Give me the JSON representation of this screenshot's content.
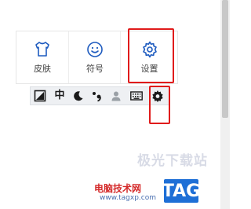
{
  "panel": {
    "items": [
      {
        "label": "皮肤",
        "icon": "shirt-icon"
      },
      {
        "label": "符号",
        "icon": "smiley-icon"
      },
      {
        "label": "设置",
        "icon": "gear-icon"
      }
    ]
  },
  "toolbar": {
    "items": [
      {
        "icon": "switch-mode-icon"
      },
      {
        "text": "中",
        "icon": "chinese-mode-icon"
      },
      {
        "icon": "moon-icon"
      },
      {
        "icon": "punctuation-icon"
      },
      {
        "icon": "user-icon"
      },
      {
        "icon": "keyboard-icon"
      },
      {
        "icon": "gear-icon"
      }
    ]
  },
  "watermark": {
    "brand": "极光下载站",
    "site_cn": "电脑技术网",
    "url": "www.tagxp.com",
    "tag": "TAG"
  },
  "colors": {
    "accent_blue": "#1e5bbf",
    "highlight_red": "#e01b1b"
  }
}
